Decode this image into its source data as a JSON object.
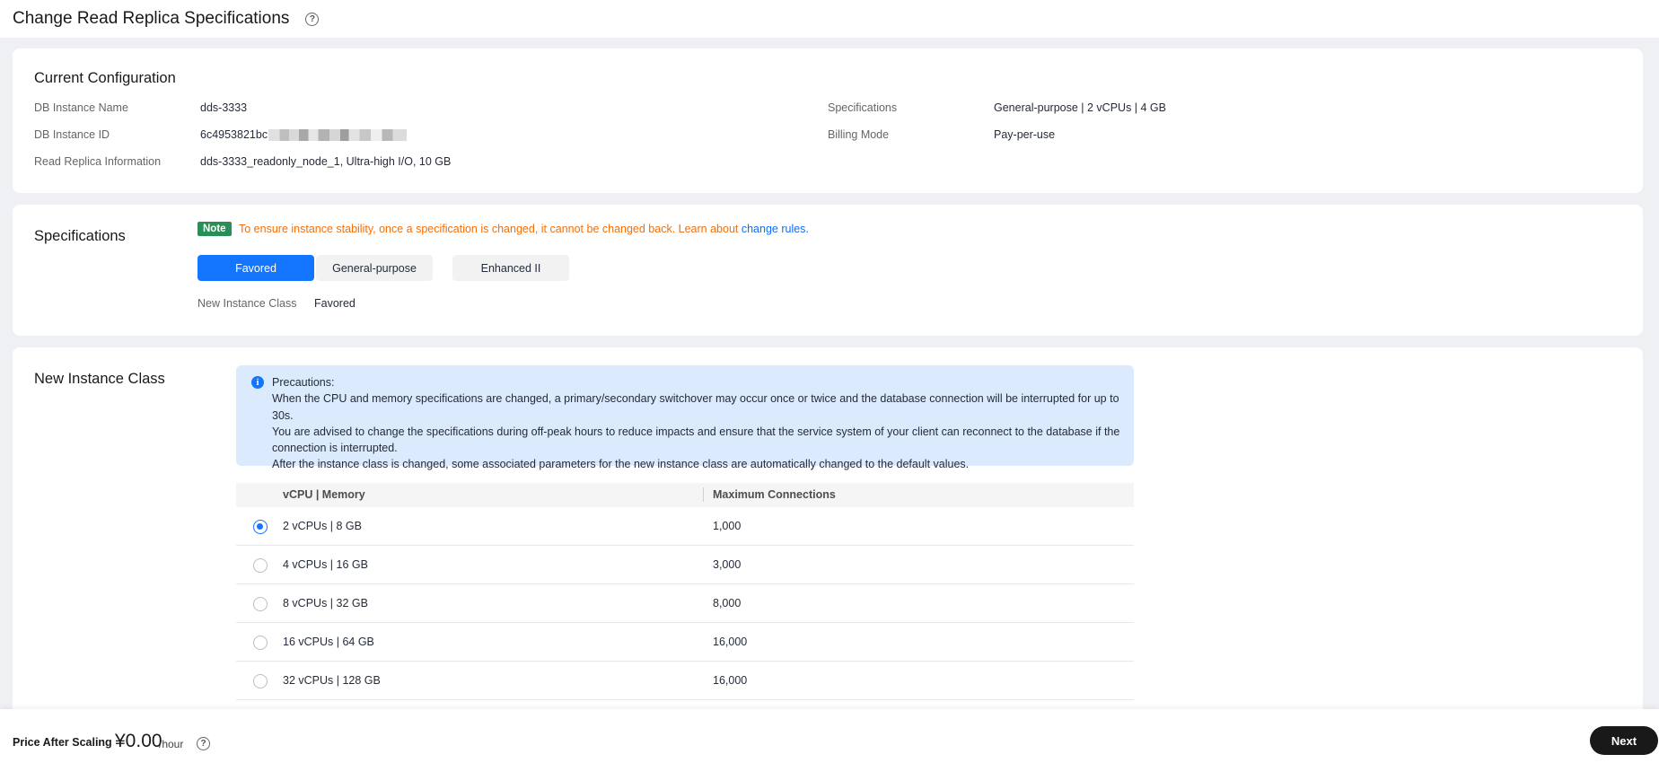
{
  "header": {
    "title": "Change Read Replica Specifications"
  },
  "current_config": {
    "title": "Current Configuration",
    "db_instance_name_label": "DB Instance Name",
    "db_instance_name": "dds-3333",
    "db_instance_id_label": "DB Instance ID",
    "db_instance_id": "6c4953821bc",
    "read_replica_label": "Read Replica Information",
    "read_replica": "dds-3333_readonly_node_1, Ultra-high I/O, 10 GB",
    "specifications_label": "Specifications",
    "specifications": "General-purpose | 2 vCPUs | 4 GB",
    "billing_mode_label": "Billing Mode",
    "billing_mode": "Pay-per-use"
  },
  "specs": {
    "title": "Specifications",
    "note_badge": "Note",
    "note_text": "To ensure instance stability, once a specification is changed, it cannot be changed back. Learn about ",
    "note_link": "change rules",
    "note_end": ".",
    "tabs": [
      {
        "label": "Favored",
        "active": true
      },
      {
        "label": "General-purpose",
        "active": false
      },
      {
        "label": "Enhanced II",
        "active": false
      }
    ],
    "new_class_label": "New Instance Class",
    "new_class_value": "Favored"
  },
  "new_class": {
    "title": "New Instance Class",
    "precautions": [
      "Precautions:",
      "When the CPU and memory specifications are changed, a primary/secondary switchover may occur once or twice and the database connection will be interrupted for up to 30s.",
      "You are advised to change the specifications during off-peak hours to reduce impacts and ensure that the service system of your client can reconnect to the database if the",
      "connection is interrupted.",
      "After the instance class is changed, some associated parameters for the new instance class are automatically changed to the default values."
    ],
    "table": {
      "col1": "vCPU | Memory",
      "col2": "Maximum Connections",
      "rows": [
        {
          "spec": "2 vCPUs | 8 GB",
          "max": "1,000",
          "selected": true
        },
        {
          "spec": "4 vCPUs | 16 GB",
          "max": "3,000",
          "selected": false
        },
        {
          "spec": "8 vCPUs | 32 GB",
          "max": "8,000",
          "selected": false
        },
        {
          "spec": "16 vCPUs | 64 GB",
          "max": "16,000",
          "selected": false
        },
        {
          "spec": "32 vCPUs | 128 GB",
          "max": "16,000",
          "selected": false
        }
      ]
    }
  },
  "footer": {
    "price_label": "Price After Scaling",
    "price": "¥0.00",
    "unit": "/hour",
    "next_label": "Next"
  },
  "colors": {
    "accent": "#1476ff",
    "note_badge": "#2a8f57",
    "warning": "#f66f08",
    "info_bg": "#dbeafd",
    "next_button": "#191919"
  },
  "icons": {
    "help": "question-circle-icon",
    "info": "info-circle-icon",
    "radio": "radio-icon"
  }
}
